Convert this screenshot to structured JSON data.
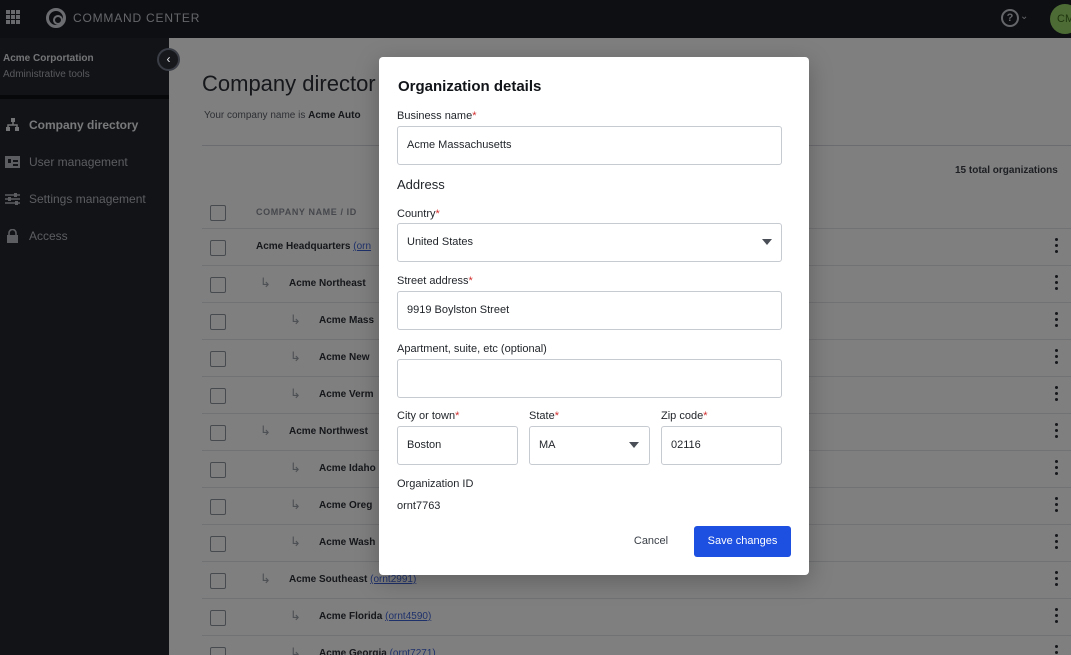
{
  "topbar": {
    "brand": "COMMAND CENTER",
    "avatar_initials": "CM",
    "help_icon": "question-circle-icon"
  },
  "sidebar": {
    "org_name": "Acme Corportation",
    "org_subtitle": "Administrative tools",
    "items": [
      {
        "label": "Company directory",
        "icon": "directory-icon",
        "active": true
      },
      {
        "label": "User management",
        "icon": "users-icon",
        "active": false
      },
      {
        "label": "Settings management",
        "icon": "sliders-icon",
        "active": false
      },
      {
        "label": "Access",
        "icon": "lock-icon",
        "active": false
      }
    ]
  },
  "page": {
    "title": "Company director",
    "subtitle_prefix": "Your company name is ",
    "subtitle_company": "Acme Auto",
    "total_count": "15 total organizations",
    "column_header": "COMPANY NAME / ID",
    "rows": [
      {
        "name": "Acme Headquarters",
        "id": "(orn",
        "level": 0
      },
      {
        "name": "Acme Northeast",
        "id": "",
        "level": 1
      },
      {
        "name": "Acme Mass",
        "id": "",
        "level": 2
      },
      {
        "name": "Acme New",
        "id": "",
        "level": 2
      },
      {
        "name": "Acme Verm",
        "id": "",
        "level": 2
      },
      {
        "name": "Acme Northwest",
        "id": "",
        "level": 1
      },
      {
        "name": "Acme Idaho",
        "id": "",
        "level": 2
      },
      {
        "name": "Acme Oreg",
        "id": "",
        "level": 2
      },
      {
        "name": "Acme Wash",
        "id": "",
        "level": 2
      },
      {
        "name": "Acme Southeast",
        "id": "(ornt2991)",
        "level": 1
      },
      {
        "name": "Acme Florida",
        "id": "(ornt4590)",
        "level": 2
      },
      {
        "name": "Acme Georgia",
        "id": "(ornt7271)",
        "level": 2
      }
    ]
  },
  "modal": {
    "title": "Organization details",
    "business_name_label": "Business name",
    "business_name_value": "Acme Massachusetts",
    "address_heading": "Address",
    "country_label": "Country",
    "country_value": "United States",
    "street_label": "Street address",
    "street_value": "9919 Boylston Street",
    "apt_label": "Apartment, suite, etc (optional)",
    "apt_value": "",
    "city_label": "City or town",
    "city_value": "Boston",
    "state_label": "State",
    "state_value": "MA",
    "zip_label": "Zip code",
    "zip_value": "02116",
    "org_id_label": "Organization ID",
    "org_id_value": "ornt7763",
    "required_marker": "*",
    "cancel_label": "Cancel",
    "save_label": "Save changes"
  },
  "colors": {
    "primary": "#1d4fe0",
    "required": "#d32f2f",
    "topbar": "#1c1e24",
    "sidebar": "#24262d"
  }
}
